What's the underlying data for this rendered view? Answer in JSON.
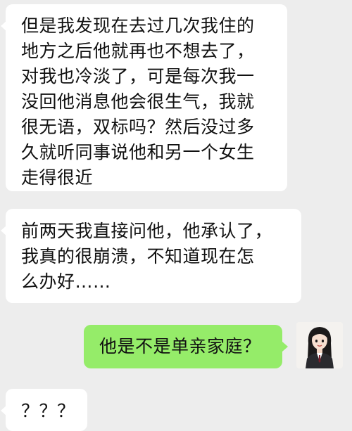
{
  "messages": [
    {
      "side": "received",
      "lines": [
        "但是我发现在去过几次我住的",
        "地方之后他就再也不想去了，",
        "对我也冷淡了，可是每次我一",
        "没回他消息他会很生气，我就",
        "很无语，双标吗？然后没过多",
        "久就听同事说他和另一个女生",
        "走得很近"
      ]
    },
    {
      "side": "received",
      "lines": [
        "前两天我直接问他，他承认了，",
        "我真的很崩溃，不知道现在怎",
        "么办好……"
      ]
    },
    {
      "side": "sent",
      "lines": [
        "他是不是单亲家庭？"
      ]
    },
    {
      "side": "received",
      "lines": [
        "？？？"
      ]
    }
  ],
  "avatar": {
    "icon": "woman-avatar-icon"
  },
  "colors": {
    "background": "#ededed",
    "received_bubble": "#ffffff",
    "sent_bubble": "#95ec69"
  }
}
